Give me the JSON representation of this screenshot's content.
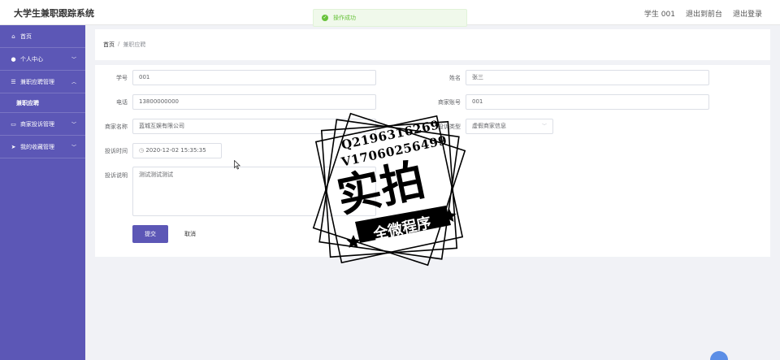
{
  "app": {
    "title": "大学生兼职跟踪系统",
    "user_label": "学生 001",
    "to_front_label": "退出到前台",
    "logout_label": "退出登录"
  },
  "toast": {
    "message": "操作成功",
    "type": "success",
    "color": "#67c23a"
  },
  "sidebar": {
    "bg_color": "#5c57b6",
    "items": [
      {
        "label": "首页",
        "icon": "home-icon"
      },
      {
        "label": "个人中心",
        "icon": "user-icon",
        "expandable": true
      },
      {
        "label": "兼职应聘管理",
        "icon": "list-icon",
        "expandable": true,
        "expanded": true,
        "children": [
          {
            "label": "兼职应聘"
          }
        ]
      },
      {
        "label": "商家投诉管理",
        "icon": "card-icon",
        "expandable": true
      },
      {
        "label": "我的收藏管理",
        "icon": "send-icon",
        "expandable": true
      }
    ]
  },
  "breadcrumb": {
    "home": "首页",
    "separator": "/",
    "current": "兼职应聘"
  },
  "form": {
    "student_id": {
      "label": "学号",
      "value": "001"
    },
    "name": {
      "label": "姓名",
      "value": "张三"
    },
    "phone": {
      "label": "电话",
      "value": "13800000000"
    },
    "merchant_account": {
      "label": "商家账号",
      "value": "001"
    },
    "merchant_name": {
      "label": "商家名称",
      "value": "蓝城互娱有限公司"
    },
    "complaint_type": {
      "label": "投诉类型",
      "value": "虚假商家信息"
    },
    "complaint_time": {
      "label": "投诉时间",
      "value": "2020-12-02 15:35:35"
    },
    "complaint_desc": {
      "label": "投诉说明",
      "value": "测试测试测试"
    },
    "submit_label": "提交",
    "cancel_label": "取消"
  },
  "watermark": {
    "line1": "Q2196316269",
    "line2": "V17060256499",
    "big_text": "实拍",
    "ribbon_text": "全微程序"
  }
}
